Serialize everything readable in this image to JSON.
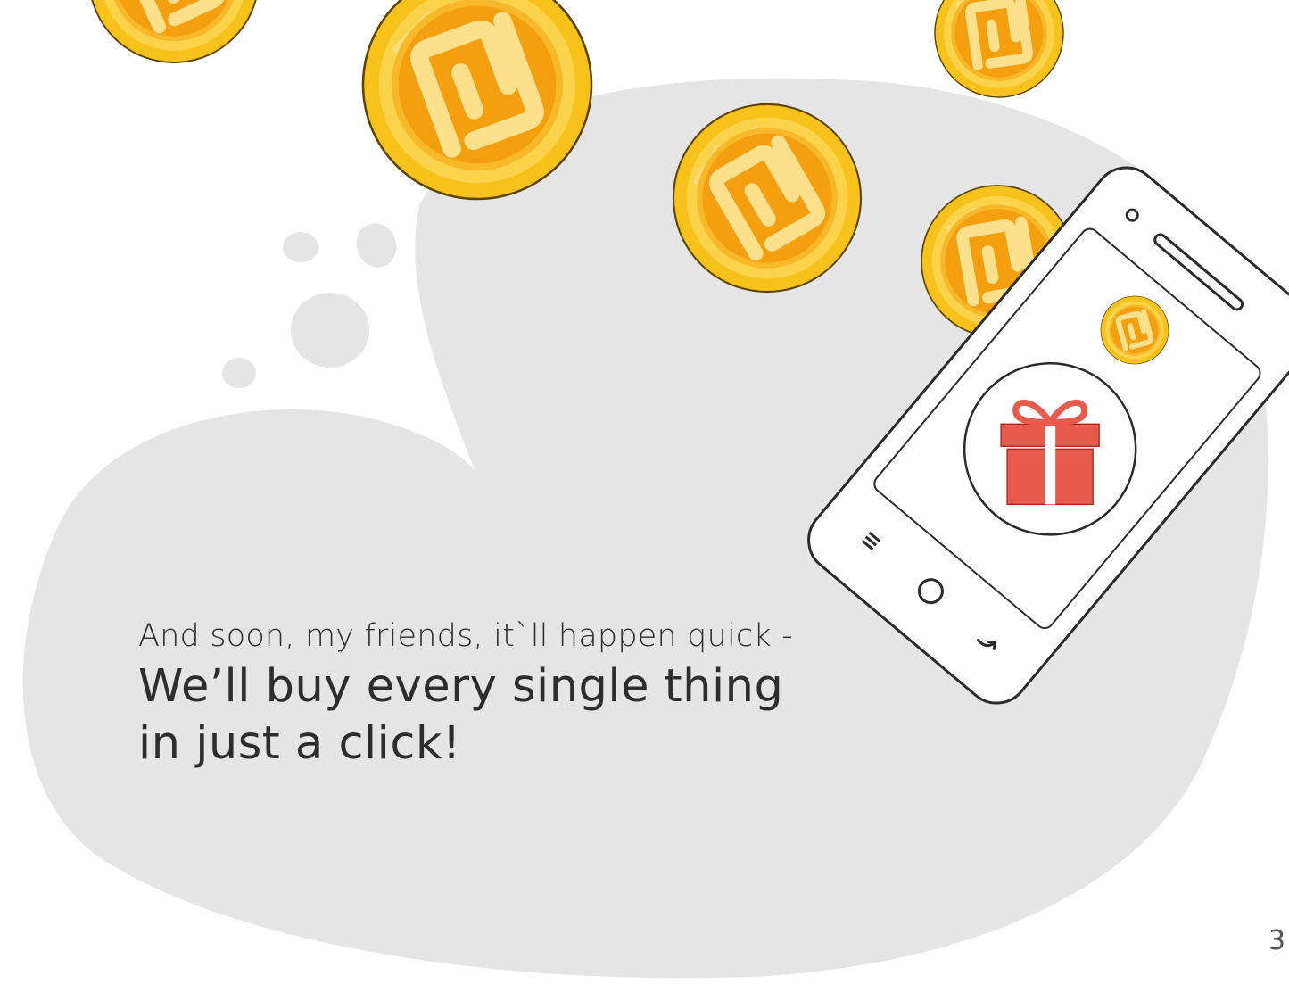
{
  "verse": {
    "line1": "And soon, my friends, it`ll happen quick -",
    "line2": "We’ll buy every single thing",
    "line3": "in just a click!"
  },
  "page_number": "3",
  "colors": {
    "blob": "#e5e5e5",
    "coin_gold": "#f8c21c",
    "coin_inner": "#f39f10",
    "coin_symbol": "#fde08c",
    "gift": "#e65b4c",
    "phone_outline": "#2b2b2b"
  },
  "icons": [
    "coin-icon",
    "phone-illustration",
    "gift-icon",
    "menu-icon",
    "home-icon",
    "back-icon"
  ]
}
